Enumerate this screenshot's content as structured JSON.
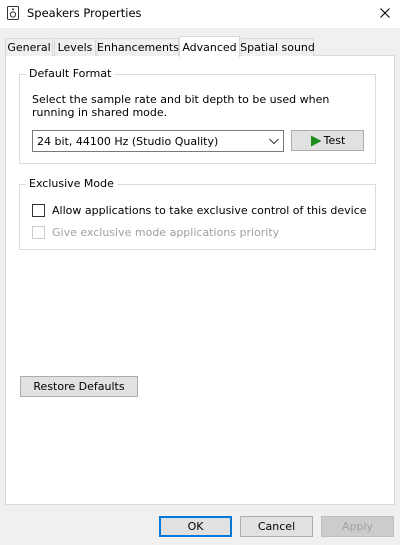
{
  "window": {
    "title": "Speakers Properties",
    "icon": "speaker-icon",
    "close_icon": "close-icon"
  },
  "tabs": [
    {
      "label": "General",
      "active": false
    },
    {
      "label": "Levels",
      "active": false
    },
    {
      "label": "Enhancements",
      "active": false
    },
    {
      "label": "Advanced",
      "active": true
    },
    {
      "label": "Spatial sound",
      "active": false
    }
  ],
  "default_format": {
    "group_title": "Default Format",
    "description": "Select the sample rate and bit depth to be used when running in shared mode.",
    "selected_value": "24 bit, 44100 Hz (Studio Quality)",
    "test_label": "Test",
    "test_icon": "play-icon"
  },
  "exclusive_mode": {
    "group_title": "Exclusive Mode",
    "allow_exclusive_label": "Allow applications to take exclusive control of this device",
    "allow_exclusive_checked": false,
    "priority_label": "Give exclusive mode applications priority",
    "priority_checked": false,
    "priority_enabled": false
  },
  "restore_defaults_label": "Restore Defaults",
  "footer": {
    "ok_label": "OK",
    "cancel_label": "Cancel",
    "apply_label": "Apply"
  },
  "colors": {
    "accent": "#0078d7",
    "play_green": "#1e8c1e"
  }
}
